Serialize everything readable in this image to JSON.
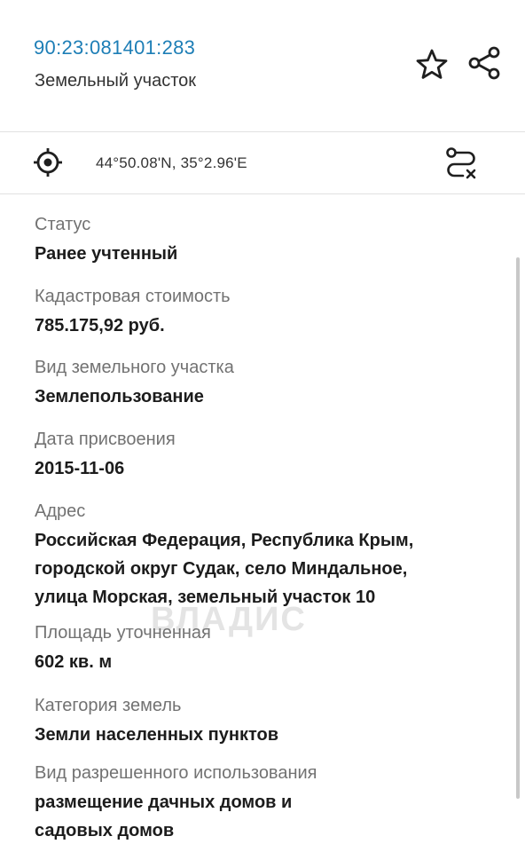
{
  "header": {
    "cadastral_number": "90:23:081401:283",
    "object_type": "Земельный участок",
    "icons": {
      "favorite": "star-outline-icon",
      "share": "share-icon"
    }
  },
  "location": {
    "coordinates": "44°50.08'N, 35°2.96'E",
    "icons": {
      "locate": "target-icon",
      "route": "route-icon"
    }
  },
  "fields": [
    {
      "label": "Статус",
      "value": "Ранее учтенный"
    },
    {
      "label": "Кадастровая стоимость",
      "value": "785.175,92 руб."
    },
    {
      "label": "Вид земельного участка",
      "value": "Землепользование"
    },
    {
      "label": "Дата присвоения",
      "value": "2015-11-06"
    },
    {
      "label": "Адрес",
      "value_lines": [
        "Российская Федерация, Республика Крым,",
        "городской округ Судак, село Миндальное,",
        "улица Морская, земельный участок 10"
      ]
    },
    {
      "label": "Площадь уточненная",
      "value": "602 кв. м"
    },
    {
      "label": "Категория земель",
      "value": "Земли населенных пунктов"
    },
    {
      "label": "Вид разрешенного использования",
      "value_lines": [
        "размещение дачных домов и",
        "садовых домов"
      ]
    }
  ],
  "watermark": "ВЛАДИС",
  "colors": {
    "accent": "#1d7eb6",
    "label": "#727272",
    "value": "#1c1c1c",
    "divider": "#e1e1e1"
  }
}
